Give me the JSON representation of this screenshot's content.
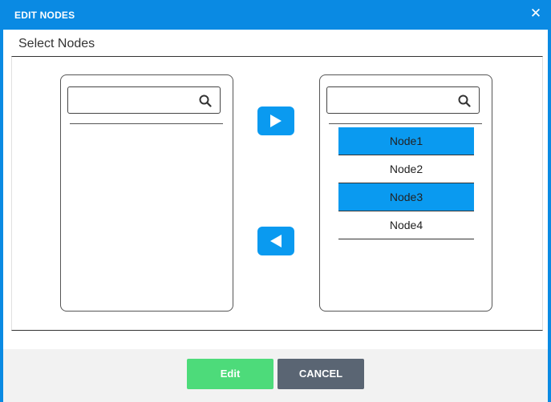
{
  "window": {
    "title": "EDIT NODES",
    "close_glyph": "✕"
  },
  "section": {
    "title": "Select Nodes"
  },
  "left_list": {
    "search_value": "",
    "items": []
  },
  "right_list": {
    "search_value": "",
    "items": [
      {
        "label": "Node1",
        "selected": true
      },
      {
        "label": "Node2",
        "selected": false
      },
      {
        "label": "Node3",
        "selected": true
      },
      {
        "label": "Node4",
        "selected": false
      }
    ]
  },
  "icons": {
    "search": "search-icon",
    "move_right": "triangle-right-icon",
    "move_left": "triangle-left-icon",
    "close": "close-icon"
  },
  "colors": {
    "titlebar": "#0a8ae3",
    "accent": "#0a9af0",
    "edit_button": "#4ddb7a",
    "cancel_button": "#5a6573"
  },
  "footer": {
    "edit_label": "Edit",
    "cancel_label": "CANCEL"
  }
}
